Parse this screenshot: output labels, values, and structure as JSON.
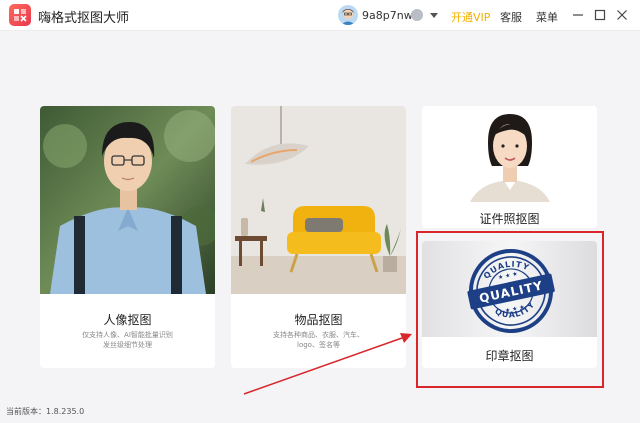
{
  "app": {
    "title": "嗨格式抠图大师",
    "username": "9a8p7nw",
    "vip_label": "开通VIP",
    "service_label": "客服",
    "menu_label": "菜单",
    "version_text": "当前版本：1.8.235.0"
  },
  "cards": {
    "portrait": {
      "title": "人像抠图",
      "desc_line1": "仅支持人像、AI智能批量识别",
      "desc_line2": "发丝级细节处理"
    },
    "object": {
      "title": "物品抠图",
      "desc_line1": "支持各种商品、衣服、汽车、",
      "desc_line2": "logo、签名等"
    },
    "id_photo": {
      "title": "证件照抠图"
    },
    "stamp": {
      "title": "印章抠图",
      "stamp_top_text": "QUALITY",
      "stamp_bottom_text": "QUALITY",
      "stamp_center_text": "QUALITY"
    }
  },
  "colors": {
    "vip": "#f3b000",
    "highlight": "#d8262b",
    "arrow": "#d8262b"
  },
  "icons": [
    "app-logo-icon",
    "avatar-icon",
    "badge-icon",
    "chevron-down-icon",
    "minimize-icon",
    "maximize-icon",
    "close-icon"
  ]
}
